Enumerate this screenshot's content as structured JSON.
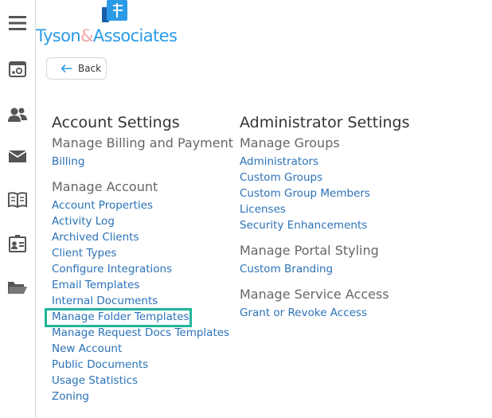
{
  "brand": {
    "name_part1": "Tyson",
    "name_amp": "&",
    "name_part2": "Associates",
    "primary_color": "#2b9be8",
    "amp_color": "#f4a6a6"
  },
  "sidebar": {
    "icons": [
      "menu-icon",
      "dashboard-settings-icon",
      "users-icon",
      "mail-icon",
      "book-icon",
      "contact-card-icon",
      "folder-icon"
    ]
  },
  "back_button": {
    "label": "Back"
  },
  "account_settings": {
    "title": "Account Settings",
    "sections": [
      {
        "heading": "Manage Billing and Payment",
        "links": [
          "Billing"
        ]
      },
      {
        "heading": "Manage Account",
        "links": [
          "Account Properties",
          "Activity Log",
          "Archived Clients",
          "Client Types",
          "Configure Integrations",
          "Email Templates",
          "Internal Documents",
          "Manage Folder Templates",
          "Manage Request Docs Templates",
          "New Account",
          "Public Documents",
          "Usage Statistics",
          "Zoning"
        ]
      }
    ]
  },
  "administrator_settings": {
    "title": "Administrator Settings",
    "sections": [
      {
        "heading": "Manage Groups",
        "links": [
          "Administrators",
          "Custom Groups",
          "Custom Group Members",
          "Licenses",
          "Security Enhancements"
        ]
      },
      {
        "heading": "Manage Portal Styling",
        "links": [
          "Custom Branding"
        ]
      },
      {
        "heading": "Manage Service Access",
        "links": [
          "Grant or Revoke Access"
        ]
      }
    ]
  },
  "highlight_color": "#1fb59a"
}
